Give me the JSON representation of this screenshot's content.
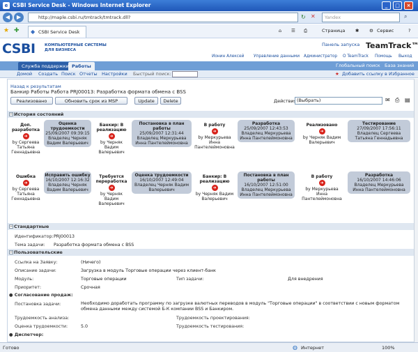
{
  "window": {
    "title": "CSBI Service Desk - Windows Internet Explorer"
  },
  "address": {
    "url": "http://maple.csbi.ru/tmtrack/tmtrack.dll?",
    "search_placeholder": "Yandex"
  },
  "toolbar": {
    "tab_label": "CSBI Service Desk",
    "page": "Страница",
    "service": "Сервис"
  },
  "header": {
    "logo": "CSBI",
    "logo_sub1": "КОМПЬЮТЕРНЫЕ СИСТЕМЫ",
    "logo_sub2": "ДЛЯ БИЗНЕСА",
    "launch_panel": "Панель запуска",
    "product": "TeamTrack™"
  },
  "userbar": {
    "user": "Ионин Алексей",
    "manage": "Управление данными",
    "admin": "Администратор",
    "about": "О TeamTrack",
    "help": "Помощь",
    "exit": "Выход"
  },
  "tabs": {
    "support": "Служба поддержки",
    "work": "Работы",
    "global_search": "Глобальный поиск",
    "knowledge": "База знаний"
  },
  "menu": {
    "home": "Домой",
    "create": "Создать",
    "search": "Поиск",
    "reports": "Отчеты",
    "settings": "Настройки",
    "fast": "Быстрый поиск:",
    "fav": "Добавить ссылку в Избранное"
  },
  "item": {
    "back": "Назад к результатам",
    "title": "Банкир Работы Работа  PRJ00013: Разработка формата обмена с BSS",
    "btn_done": "Реализовано",
    "btn_msp": "Обновить срок из MSP",
    "btn_update": "Update",
    "btn_delete": "Delete",
    "actions_label": "Действия:",
    "actions_value": "(Выбрать)"
  },
  "sections": {
    "history": "История состояний",
    "standard": "Стандартные",
    "custom": "Пользовательские",
    "agree": "Согласование продаж:",
    "dispatch": "Диспетчер:"
  },
  "history": [
    {
      "title": "Доп. разработка",
      "date": "",
      "by": "by Сергеева Татьяна Геннадьевна",
      "box": false
    },
    {
      "title": "Оценка трудоемкости",
      "date": "25/09/2007 09:39:15",
      "by": "Владелец Черняк Вадим Валерьевич",
      "box": true
    },
    {
      "title": "Банкир: В реализацию",
      "date": "",
      "by": "by Черняк Вадим Валерьевич",
      "box": false
    },
    {
      "title": "Постановка в план работы",
      "date": "25/09/2007 12:31:44",
      "by": "Владелец Меркурьева Инна Пантелеймоновна",
      "box": true
    },
    {
      "title": "В работу",
      "date": "",
      "by": "by Меркурьева Инна Пантелеймоновна",
      "box": false
    },
    {
      "title": "Разработка",
      "date": "25/09/2007 12:43:53",
      "by": "Владелец Меркурьева Инна Пантелеймоновна",
      "box": true
    },
    {
      "title": "Реализовано",
      "date": "",
      "by": "by Черняк Вадим Валерьевич",
      "box": false
    },
    {
      "title": "Тестирование",
      "date": "27/09/2007 17:56:11",
      "by": "Владелец Сергеева Татьяна Геннадьевна",
      "box": true
    },
    {
      "title": "Ошибка",
      "date": "",
      "by": "by Сергеева Татьяна Геннадьевна",
      "box": false
    },
    {
      "title": "Исправить ошибку",
      "date": "16/10/2007 12:16:32",
      "by": "Владелец Черняк Вадим Валерьевич",
      "box": true
    },
    {
      "title": "Требуется переработка",
      "date": "",
      "by": "by Черняк Вадим Валерьевич",
      "box": false
    },
    {
      "title": "Оценка трудоемкости",
      "date": "16/10/2007 12:49:04",
      "by": "Владелец Черняк Вадим Валерьевич",
      "box": true
    },
    {
      "title": "Банкир: В реализацию",
      "date": "",
      "by": "by Черняк Вадим Валерьевич",
      "box": false
    },
    {
      "title": "Постановка в план работы",
      "date": "16/10/2007 12:51:00",
      "by": "Владелец Меркурьева Инна Пантелеймоновна",
      "box": true
    },
    {
      "title": "В работу",
      "date": "",
      "by": "by Меркурьева Инна Пантелеймоновна",
      "box": false
    },
    {
      "title": "Разработка",
      "date": "16/10/2007 14:46:06",
      "by": "Владелец Меркурьева Инна Пантелеймоновна",
      "box": true
    }
  ],
  "fields": {
    "id_label": "Идентификатор:",
    "id_value": "PRJ00013",
    "subject_label": "Тема задачи:",
    "subject_value": "Разработка формата обмена с BSS",
    "link_label": "Ссылка на Заявку:",
    "link_value": "(Ничего)",
    "desc_label": "Описание задачи:",
    "desc_value": "Загрузка в модуль Торговые операции через клиент-банк",
    "module_label": "Модуль:",
    "module_value": "Торговые операции",
    "type_label": "Тип задачи:",
    "type_value": "Для внедрения",
    "prio_label": "Приоритет:",
    "prio_value": "Срочная",
    "task_label": "Постановка задачи:",
    "task_value": "Необходимо доработать программу по загрузке валютных переводов в модуль \"Торговые операции\" в соответствии с новым форматом обмена данными между системой Б-К компании BSS и Банкиром.",
    "analysis_label": "Трудоемкость анализа:",
    "design_label": "Трудоемкость проектирования:",
    "est_label": "Оценка трудоемкости:",
    "est_value": "5.0",
    "test_label": "Трудоемкость тестирования:"
  },
  "status": {
    "text": "Готово",
    "zone": "Интернет",
    "zoom": "100%"
  }
}
